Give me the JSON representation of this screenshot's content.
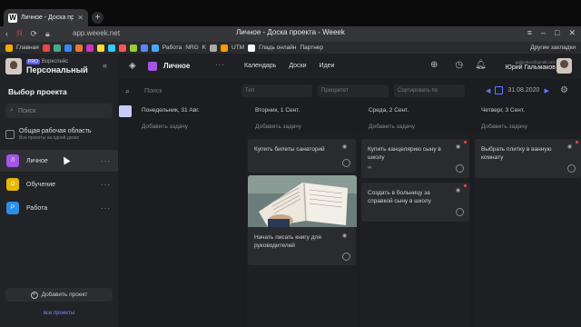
{
  "browser": {
    "tab_title": "Личное - Доска проекта",
    "window_title": "Личное - Доска проекта - Weeek",
    "url": "app.weeek.net",
    "bookmarks": [
      "Главная",
      "Работа",
      "NRG",
      "K",
      "UTM",
      "Гладь онлайн",
      "Партнер",
      "Другие закладки"
    ]
  },
  "sidebar": {
    "workspace_badge": "PRO",
    "workspace_sub": "Воркспейс",
    "workspace_name": "Персональный",
    "title": "Выбор проекта",
    "search_placeholder": "Поиск",
    "common_title": "Общая рабочая область",
    "common_sub": "Все проекты на одной доске",
    "projects": [
      {
        "letter": "Л",
        "name": "Личное",
        "color": "#a455e6"
      },
      {
        "letter": "О",
        "name": "Обучение",
        "color": "#e6b800"
      },
      {
        "letter": "Р",
        "name": "Работа",
        "color": "#2a8fe6"
      }
    ],
    "add_project": "Добавить проект",
    "all_projects": "все проекты"
  },
  "header": {
    "project": "Личное",
    "nav": [
      "Календарь",
      "Доски",
      "Идеи"
    ],
    "user_email": "galmakov@gmail.com",
    "user_name": "Юрий Гальмаков"
  },
  "filters": {
    "search": "Поиск",
    "type": "Тип",
    "priority": "Приоритет",
    "sort": "Сортировать по",
    "date": "31.08.2020"
  },
  "columns": [
    {
      "date": "Понедельник, 31 Авг.",
      "add": "Добавить задачу"
    },
    {
      "date": "Вторник, 1 Сент.",
      "add": "Добавить задачу"
    },
    {
      "date": "Среда, 2 Сент.",
      "add": "Добавить задачу"
    },
    {
      "date": "Четверг, 3 Сент.",
      "add": "Добавить задачу"
    }
  ],
  "cards": {
    "tue_1": "Купить билеты санаторий",
    "tue_2": "Начать писать книгу для руководителей",
    "wed_1": "Купить канцелярию сыну в школу",
    "wed_2": "Создать в больницу за справкой сыну в школу",
    "thu_1": "Выбрать плитку в ванную комнату"
  },
  "icons": {
    "collapse": "double-chevron-left-icon",
    "search": "search-icon",
    "settings": "gear-icon",
    "add": "plus-circle-icon",
    "notifications": "bell-icon",
    "timer": "stopwatch-icon"
  }
}
